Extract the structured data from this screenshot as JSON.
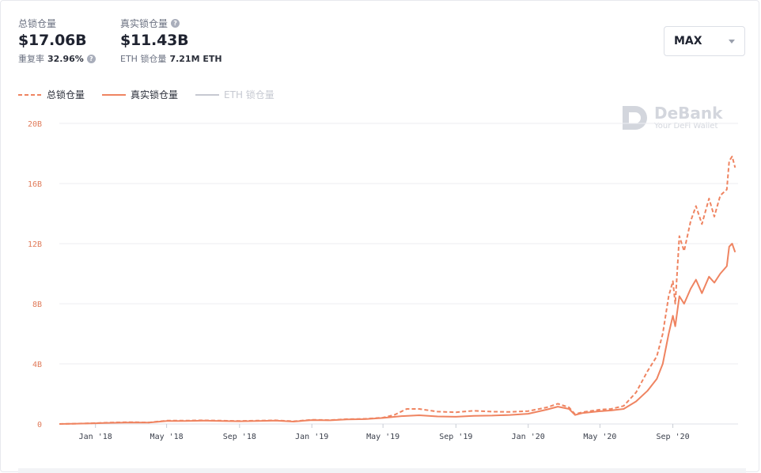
{
  "stats": {
    "total": {
      "label": "总锁仓量",
      "value": "$17.06B",
      "sub_label": "重复率",
      "sub_value": "32.96%"
    },
    "real": {
      "label": "真实锁仓量",
      "value": "$11.43B",
      "sub_label": "ETH 锁仓量",
      "sub_value": "7.21M ETH"
    }
  },
  "range_select": {
    "value": "MAX"
  },
  "legend": [
    {
      "name": "总锁仓量",
      "style": "dashed",
      "active": true
    },
    {
      "name": "真实锁仓量",
      "style": "solid",
      "active": true
    },
    {
      "name": "ETH 锁仓量",
      "style": "solid",
      "active": false
    }
  ],
  "watermark": {
    "title": "DeBank",
    "subtitle": "Your DeFi Wallet"
  },
  "colors": {
    "series": "#ef8461",
    "inactive": "#c6c9d1",
    "grid": "#eceef2",
    "axis_label": "#e07b5a"
  },
  "chart_data": {
    "type": "line",
    "title": "",
    "xlabel": "",
    "ylabel": "",
    "x_ticks": [
      "Jan '18",
      "May '18",
      "Sep '18",
      "Jan '19",
      "May '19",
      "Sep '19",
      "Jan '20",
      "May '20",
      "Sep '20"
    ],
    "y_ticks": [
      "0",
      "4B",
      "8B",
      "12B",
      "16B",
      "20B"
    ],
    "ylim": [
      0,
      20
    ],
    "y_unit": "B USD",
    "xlim": [
      "2017-11-01",
      "2020-12-20"
    ],
    "grid": true,
    "legend_position": "top-left",
    "series": [
      {
        "name": "总锁仓量",
        "style": "dashed",
        "points": [
          [
            "2017-11-01",
            0.0
          ],
          [
            "2017-12-01",
            0.02
          ],
          [
            "2018-01-01",
            0.06
          ],
          [
            "2018-02-01",
            0.1
          ],
          [
            "2018-03-01",
            0.12
          ],
          [
            "2018-04-01",
            0.1
          ],
          [
            "2018-05-01",
            0.22
          ],
          [
            "2018-06-01",
            0.22
          ],
          [
            "2018-07-01",
            0.24
          ],
          [
            "2018-08-01",
            0.22
          ],
          [
            "2018-09-01",
            0.2
          ],
          [
            "2018-10-01",
            0.22
          ],
          [
            "2018-11-01",
            0.24
          ],
          [
            "2018-12-01",
            0.18
          ],
          [
            "2019-01-01",
            0.28
          ],
          [
            "2019-02-01",
            0.26
          ],
          [
            "2019-03-01",
            0.32
          ],
          [
            "2019-04-01",
            0.34
          ],
          [
            "2019-05-01",
            0.42
          ],
          [
            "2019-05-20",
            0.6
          ],
          [
            "2019-06-10",
            1.0
          ],
          [
            "2019-07-01",
            1.0
          ],
          [
            "2019-08-01",
            0.82
          ],
          [
            "2019-09-01",
            0.78
          ],
          [
            "2019-10-01",
            0.88
          ],
          [
            "2019-11-01",
            0.82
          ],
          [
            "2019-12-01",
            0.8
          ],
          [
            "2020-01-01",
            0.86
          ],
          [
            "2020-02-01",
            1.1
          ],
          [
            "2020-02-20",
            1.35
          ],
          [
            "2020-03-10",
            1.1
          ],
          [
            "2020-03-20",
            0.65
          ],
          [
            "2020-04-01",
            0.78
          ],
          [
            "2020-05-01",
            0.95
          ],
          [
            "2020-05-20",
            1.0
          ],
          [
            "2020-06-10",
            1.2
          ],
          [
            "2020-07-01",
            2.1
          ],
          [
            "2020-07-20",
            3.5
          ],
          [
            "2020-08-05",
            4.5
          ],
          [
            "2020-08-15",
            6.0
          ],
          [
            "2020-08-25",
            8.5
          ],
          [
            "2020-09-01",
            9.5
          ],
          [
            "2020-09-05",
            8.0
          ],
          [
            "2020-09-12",
            12.5
          ],
          [
            "2020-09-20",
            11.5
          ],
          [
            "2020-10-01",
            13.5
          ],
          [
            "2020-10-10",
            14.5
          ],
          [
            "2020-10-20",
            13.3
          ],
          [
            "2020-11-01",
            15.0
          ],
          [
            "2020-11-10",
            13.8
          ],
          [
            "2020-11-20",
            15.2
          ],
          [
            "2020-12-01",
            15.6
          ],
          [
            "2020-12-05",
            17.5
          ],
          [
            "2020-12-10",
            17.8
          ],
          [
            "2020-12-15",
            17.06
          ]
        ]
      },
      {
        "name": "真实锁仓量",
        "style": "solid",
        "points": [
          [
            "2017-11-01",
            0.0
          ],
          [
            "2017-12-01",
            0.02
          ],
          [
            "2018-01-01",
            0.05
          ],
          [
            "2018-02-01",
            0.08
          ],
          [
            "2018-03-01",
            0.1
          ],
          [
            "2018-04-01",
            0.09
          ],
          [
            "2018-05-01",
            0.2
          ],
          [
            "2018-06-01",
            0.2
          ],
          [
            "2018-07-01",
            0.22
          ],
          [
            "2018-08-01",
            0.2
          ],
          [
            "2018-09-01",
            0.18
          ],
          [
            "2018-10-01",
            0.2
          ],
          [
            "2018-11-01",
            0.22
          ],
          [
            "2018-12-01",
            0.16
          ],
          [
            "2019-01-01",
            0.26
          ],
          [
            "2019-02-01",
            0.24
          ],
          [
            "2019-03-01",
            0.3
          ],
          [
            "2019-04-01",
            0.32
          ],
          [
            "2019-05-01",
            0.4
          ],
          [
            "2019-06-01",
            0.52
          ],
          [
            "2019-07-01",
            0.58
          ],
          [
            "2019-08-01",
            0.5
          ],
          [
            "2019-09-01",
            0.48
          ],
          [
            "2019-10-01",
            0.54
          ],
          [
            "2019-11-01",
            0.56
          ],
          [
            "2019-12-01",
            0.6
          ],
          [
            "2020-01-01",
            0.68
          ],
          [
            "2020-02-01",
            0.95
          ],
          [
            "2020-02-20",
            1.15
          ],
          [
            "2020-03-10",
            1.0
          ],
          [
            "2020-03-20",
            0.6
          ],
          [
            "2020-04-01",
            0.72
          ],
          [
            "2020-05-01",
            0.85
          ],
          [
            "2020-05-20",
            0.9
          ],
          [
            "2020-06-10",
            1.0
          ],
          [
            "2020-07-01",
            1.5
          ],
          [
            "2020-07-20",
            2.2
          ],
          [
            "2020-08-05",
            3.0
          ],
          [
            "2020-08-15",
            4.0
          ],
          [
            "2020-08-25",
            6.0
          ],
          [
            "2020-09-01",
            7.2
          ],
          [
            "2020-09-05",
            6.5
          ],
          [
            "2020-09-12",
            8.5
          ],
          [
            "2020-09-20",
            8.0
          ],
          [
            "2020-10-01",
            9.0
          ],
          [
            "2020-10-10",
            9.6
          ],
          [
            "2020-10-20",
            8.7
          ],
          [
            "2020-11-01",
            9.8
          ],
          [
            "2020-11-10",
            9.4
          ],
          [
            "2020-11-20",
            10.0
          ],
          [
            "2020-12-01",
            10.5
          ],
          [
            "2020-12-05",
            11.8
          ],
          [
            "2020-12-10",
            12.0
          ],
          [
            "2020-12-15",
            11.43
          ]
        ]
      }
    ]
  }
}
